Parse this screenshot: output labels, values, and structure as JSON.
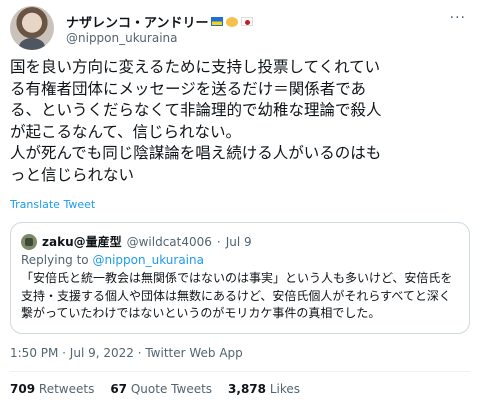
{
  "author": {
    "display_name": "ナザレンコ・アンドリー",
    "handle": "@nippon_ukuraina",
    "flags": [
      "flag-ukraine-icon",
      "handshake-icon",
      "flag-japan-icon"
    ],
    "more_icon": "ellipsis-icon"
  },
  "tweet": {
    "text": "国を良い方向に変えるために支持し投票してくれてい\nる有権者団体にメッセージを送るだけ＝関係者であ\nる、というくだらなくて非論理的で幼稚な理論で殺人\nが起こるなんて、信じられない。\n人が死んでも同じ陰謀論を唱え続ける人がいるのはも\nっと信じられない",
    "translate_label": "Translate Tweet"
  },
  "quote": {
    "name": "zaku@量産型",
    "handle": "@wildcat4006",
    "separator": "·",
    "date": "Jul 9",
    "replying_prefix": "Replying to ",
    "replying_to": "@nippon_ukuraina",
    "text": "「安倍氏と統一教会は無関係ではないのは事実」という人も多いけど、安倍氏を\n支持・支援する個人や団体は無数にあるけど、安倍氏個人がそれらすべてと深く\n繋がっていたわけではないというのがモリカケ事件の真相でした。"
  },
  "meta": {
    "timestamp": "1:50 PM · Jul 9, 2022 · Twitter Web App"
  },
  "stats": {
    "retweets_count": "709",
    "retweets_label": "Retweets",
    "quotes_count": "67",
    "quotes_label": "Quote Tweets",
    "likes_count": "3,878",
    "likes_label": "Likes"
  }
}
